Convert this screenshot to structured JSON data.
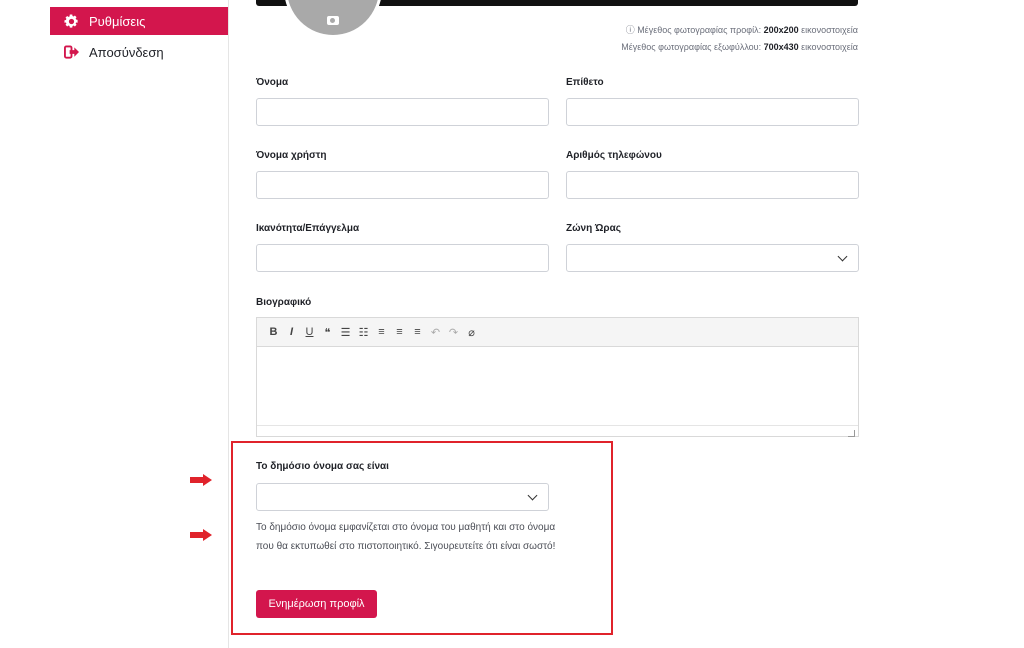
{
  "sidebar": {
    "items": [
      {
        "label": "Ρυθμίσεις",
        "icon": "gear-icon",
        "active": true
      },
      {
        "label": "Αποσύνδεση",
        "icon": "logout-icon",
        "active": false
      }
    ]
  },
  "photo_notes": {
    "profile_prefix": "ⓘ Μέγεθος φωτογραφίας προφίλ: ",
    "profile_size": "200x200",
    "profile_unit": " εικονοστοιχεία",
    "cover_prefix": "Μέγεθος φωτογραφίας εξωφύλλου: ",
    "cover_size": "700x430",
    "cover_unit": " εικονοστοιχεία"
  },
  "form": {
    "first_name_label": "Όνομα",
    "first_name_value": "",
    "last_name_label": "Επίθετο",
    "last_name_value": "",
    "username_label": "Όνομα χρήστη",
    "username_value": "",
    "phone_label": "Αριθμός τηλεφώνου",
    "phone_value": "",
    "skill_label": "Ικανότητα/Επάγγελμα",
    "skill_value": "",
    "timezone_label": "Ζώνη Ώρας",
    "timezone_value": "",
    "bio_label": "Βιογραφικό",
    "public_name_label": "Το δημόσιο όνομα σας είναι",
    "public_name_value": "",
    "public_name_help": "Το δημόσιο όνομα εμφανίζεται στο όνομα του μαθητή και στο όνομα που θα εκτυπωθεί στο πιστοποιητικό. Σιγουρευτείτε ότι είναι σωστό!",
    "submit_label": "Ενημέρωση προφίλ"
  },
  "toolbar": {
    "bold": "B",
    "italic": "I",
    "underline": "U",
    "quote": "❝",
    "bullet_list": "☰",
    "numbered_list": "☷",
    "align_left": "≡",
    "align_center": "≡",
    "align_right": "≡",
    "undo": "↶",
    "redo": "↷",
    "clear": "⌀"
  },
  "colors": {
    "accent": "#d3164d",
    "highlight": "#e0232b"
  }
}
